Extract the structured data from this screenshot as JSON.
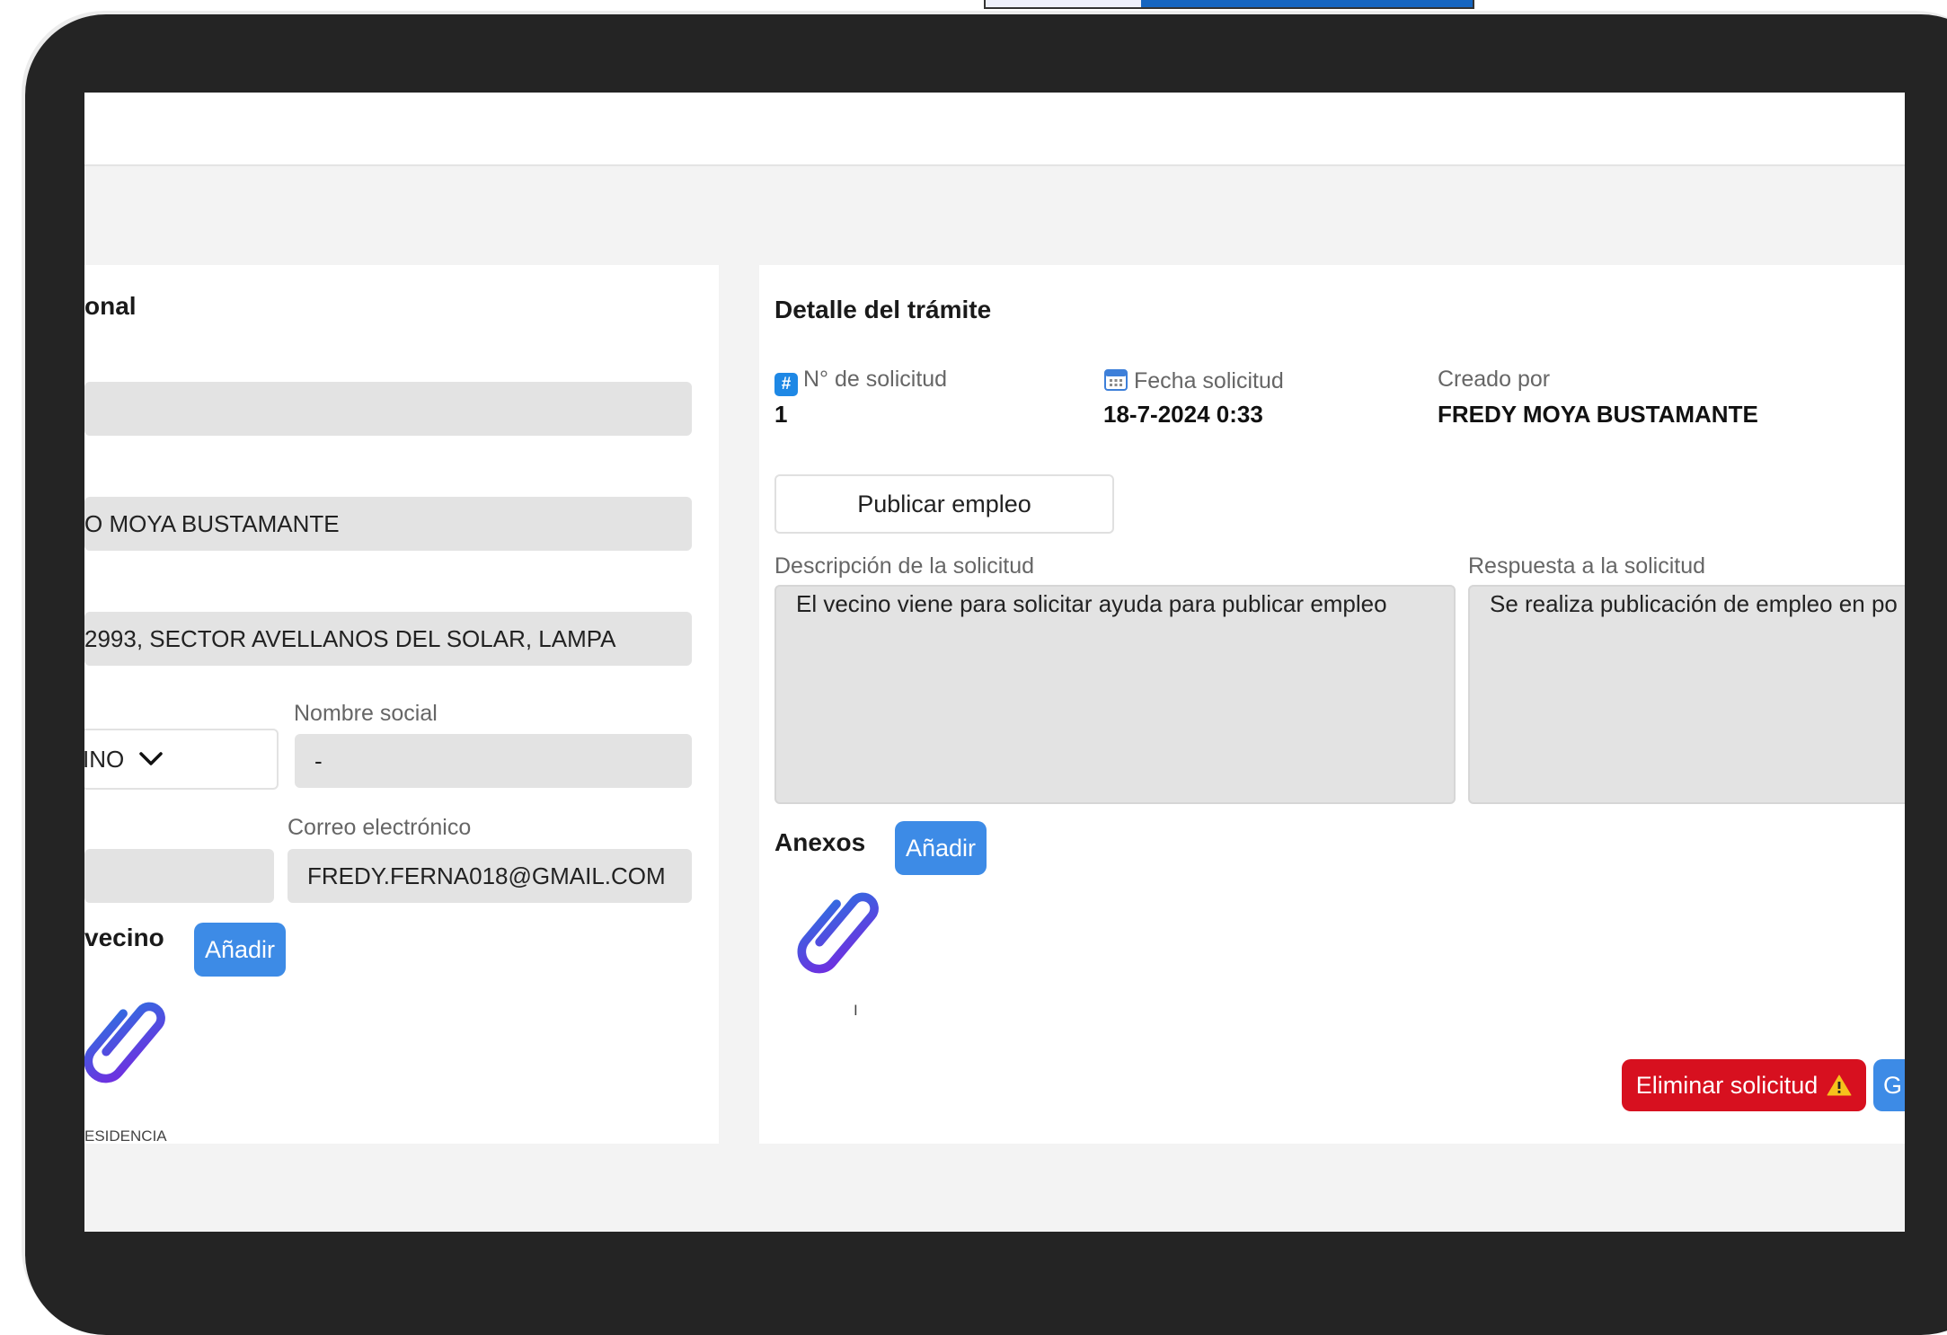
{
  "personal": {
    "title": "onal",
    "full_name": "O MOYA BUSTAMANTE",
    "address": "2993, SECTOR AVELLANOS DEL SOLAR, LAMPA",
    "gender_value": "INO",
    "social_name_label": "Nombre social",
    "social_name_value": "-",
    "email_label": "Correo electrónico",
    "email_value": "FREDY.FERNA018@GMAIL.COM",
    "docs_title": "vecino",
    "add_label": "Añadir",
    "attachment_caption": "ESIDENCIA"
  },
  "detail": {
    "title": "Detalle del trámite",
    "request_no_label": "N° de solicitud",
    "request_no_value": "1",
    "date_label": "Fecha solicitud",
    "date_value": "18-7-2024 0:33",
    "created_by_label": "Creado por",
    "created_by_value": "FREDY MOYA BUSTAMANTE",
    "type_button": "Publicar empleo",
    "description_label": "Descripción de la solicitud",
    "description_value": "El vecino viene para solicitar ayuda para publicar empleo",
    "response_label": "Respuesta a la solicitud",
    "response_value": "Se realiza publicación de empleo en po",
    "annex_title": "Anexos",
    "annex_add_label": "Añadir",
    "annex_caption": "I",
    "delete_button": "Eliminar solicitud",
    "save_button_partial": "G"
  },
  "colors": {
    "bezel": "#242424",
    "accent_blue": "#3d8be6",
    "danger_red": "#d7101f",
    "field_gray": "#e3e3e3"
  }
}
